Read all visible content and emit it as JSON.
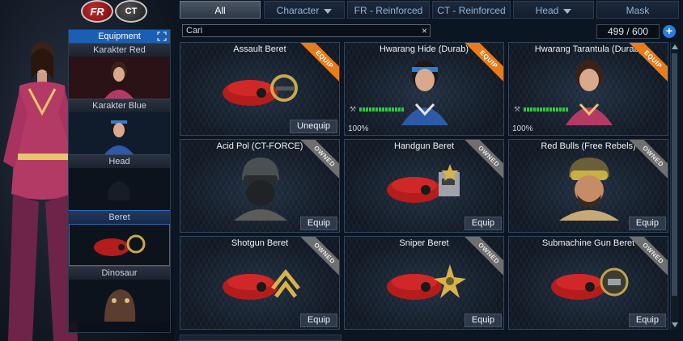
{
  "logos": {
    "fr": "FR",
    "ct": "CT"
  },
  "equipment": {
    "title": "Equipment",
    "slots": [
      {
        "label": "Karakter Red"
      },
      {
        "label": "Karakter Blue"
      },
      {
        "label": "Head"
      },
      {
        "label": "Beret"
      },
      {
        "label": "Dinosaur"
      }
    ]
  },
  "tabs": [
    {
      "label": "All",
      "active": true
    },
    {
      "label": "Character",
      "dropdown": true
    },
    {
      "label": "FR - Reinforced"
    },
    {
      "label": "CT - Reinforced"
    },
    {
      "label": "Head",
      "dropdown": true
    },
    {
      "label": "Mask"
    }
  ],
  "search": {
    "value": "Cari",
    "clear_icon": "×"
  },
  "inventory": {
    "count": "499 / 600",
    "add_icon": "+"
  },
  "items": [
    {
      "title": "Assault Beret",
      "badge": "EQUIP",
      "action": "Unequip",
      "icon": "beret-assault-icon"
    },
    {
      "title": "Hwarang Hide (Durab)",
      "badge": "EQUIP",
      "durability": "100%",
      "icon": "character-blue-icon"
    },
    {
      "title": "Hwarang Tarantula (Durab)",
      "badge": "EQUIP",
      "durability": "100%",
      "icon": "character-red-icon"
    },
    {
      "title": "Acid Pol (CT-FORCE)",
      "badge": "OWNED",
      "action": "Equip",
      "icon": "soldier-mask-icon"
    },
    {
      "title": "Handgun Beret",
      "badge": "OWNED",
      "action": "Equip",
      "icon": "beret-handgun-icon"
    },
    {
      "title": "Red Bulls (Free Rebels)",
      "badge": "OWNED",
      "action": "Equip",
      "icon": "rebel-soldier-icon"
    },
    {
      "title": "Shotgun Beret",
      "badge": "OWNED",
      "action": "Equip",
      "icon": "beret-shotgun-icon"
    },
    {
      "title": "Sniper Beret",
      "badge": "OWNED",
      "action": "Equip",
      "icon": "beret-sniper-icon"
    },
    {
      "title": "Submachine Gun Beret",
      "badge": "OWNED",
      "action": "Equip",
      "icon": "beret-smg-icon"
    }
  ],
  "colors": {
    "accent": "#1a5fb4",
    "equip_badge": "#e87b1a",
    "owned_badge": "#6f6f6f",
    "durability": "#2cc93b"
  }
}
